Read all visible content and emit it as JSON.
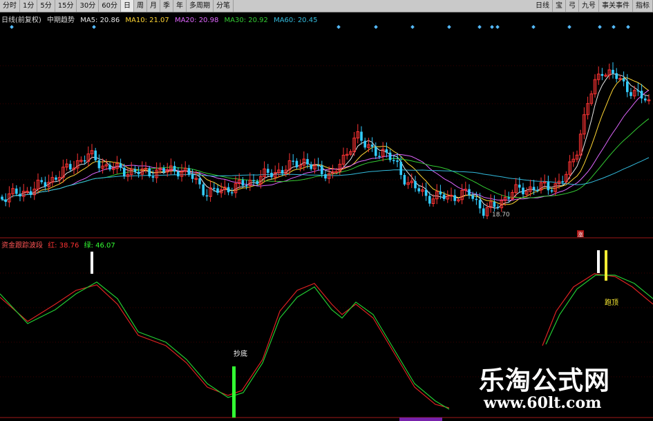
{
  "toolbar": {
    "periods": [
      "分时",
      "1分",
      "5分",
      "15分",
      "30分",
      "60分",
      "日",
      "周",
      "月",
      "季",
      "年",
      "多周期",
      "分笔"
    ],
    "active_index": 6,
    "right_items": [
      "日线",
      "宝",
      "弓",
      "九号",
      "事关事件",
      "指标"
    ]
  },
  "ma_legend": {
    "title": "日线(前复权)",
    "indicator": "中期趋势",
    "items": [
      {
        "label": "MA5: 20.86",
        "color": "#e8e8e8"
      },
      {
        "label": "MA10: 21.07",
        "color": "#ffd633"
      },
      {
        "label": "MA20: 20.98",
        "color": "#e066ff"
      },
      {
        "label": "MA30: 20.92",
        "color": "#33cc33"
      },
      {
        "label": "MA60: 20.45",
        "color": "#33bbdd"
      }
    ]
  },
  "price_chart": {
    "low_label": "18.70",
    "marker": "涨"
  },
  "indicator_legend": {
    "title": "资金跟踪波段",
    "items": [
      {
        "label": "红: 38.76",
        "color": "#ff3333"
      },
      {
        "label": "绿: 46.07",
        "color": "#33ff33"
      }
    ]
  },
  "indicator_chart": {
    "buy_label": "抄底",
    "sell_label": "跑顶"
  },
  "watermark": {
    "title": "乐淘公式网",
    "url": "www.60lt.com"
  },
  "colors": {
    "up": "#ff3333",
    "down": "#33ccff",
    "grid": "#7a0000",
    "red_line": "#dd2222",
    "green_line": "#22cc33"
  }
}
